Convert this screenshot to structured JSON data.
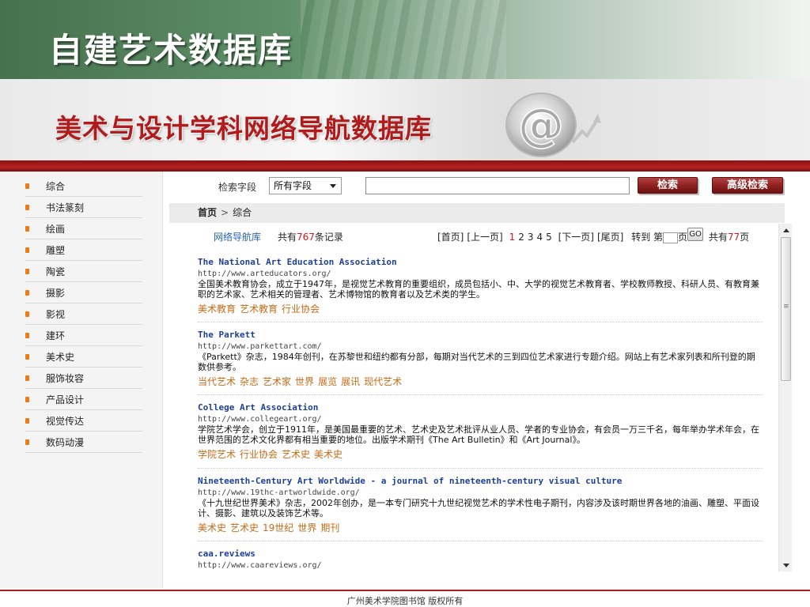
{
  "slide": {
    "title": "自建艺术数据库"
  },
  "banner": {
    "title": "美术与设计学科网络导航数据库",
    "logo_icon": "at-sign-icon"
  },
  "sidebar": {
    "items": [
      {
        "label": "综合"
      },
      {
        "label": "书法篆刻"
      },
      {
        "label": "绘画"
      },
      {
        "label": "雕塑"
      },
      {
        "label": "陶瓷"
      },
      {
        "label": "摄影"
      },
      {
        "label": "影视"
      },
      {
        "label": "建环"
      },
      {
        "label": "美术史"
      },
      {
        "label": "服饰妆容"
      },
      {
        "label": "产品设计"
      },
      {
        "label": "视觉传达"
      },
      {
        "label": "数码动漫"
      }
    ]
  },
  "search": {
    "field_label": "检索字段",
    "field_value": "所有字段",
    "input_value": "",
    "search_button": "检索",
    "advanced_button": "高级检索"
  },
  "breadcrumb": {
    "home": "首页",
    "separator": ">",
    "current": "综合"
  },
  "listing": {
    "db_link": "网络导航库",
    "count_prefix": "共有",
    "count": "767",
    "count_suffix": "条记录"
  },
  "pager": {
    "first": "[首页]",
    "prev": "[上一页]",
    "pages": [
      "1",
      "2",
      "3",
      "4",
      "5"
    ],
    "current_page": "1",
    "next": "[下一页]",
    "last": "[尾页]",
    "goto_prefix": "转到 第",
    "goto_suffix": "页",
    "go_button": "GO",
    "total_prefix": "共有",
    "total_pages": "77",
    "total_suffix": "页"
  },
  "results": [
    {
      "title": "The National Art Education Association",
      "url": "http://www.arteducators.org/",
      "description": "全国美术教育协会，成立于1947年，是视觉艺术教育的重要组织，成员包括小、中、大学的视觉艺术教育者、学校教师教授、科研人员、有教育兼职的艺术家、艺术相关的管理者、艺术博物馆的教育者以及艺术类的学生。",
      "tags": [
        "美术教育",
        "艺术教育",
        "行业协会"
      ]
    },
    {
      "title": "The Parkett",
      "url": "http://www.parkettart.com/",
      "description": "《Parkett》杂志，1984年创刊，在苏黎世和纽约都有分部，每期对当代艺术的三到四位艺术家进行专题介绍。网站上有艺术家列表和所刊登的期数供参考。",
      "tags": [
        "当代艺术",
        "杂志",
        "艺术家",
        "世界",
        "展览",
        "展讯",
        "现代艺术"
      ]
    },
    {
      "title": "College Art Association",
      "url": "http://www.collegeart.org/",
      "description": "学院艺术学会，创立于1911年，是美国最重要的艺术、艺术史及艺术批评从业人员、学者的专业协会，有会员一万三千名，每年举办学术年会，在世界范围的艺术文化界都有相当重要的地位。出版学术期刊《The Art Bulletin》和《Art Journal》。",
      "tags": [
        "学院艺术",
        "行业协会",
        "艺术史",
        "美术史"
      ]
    },
    {
      "title": "Nineteenth-Century Art Worldwide - a journal of nineteenth-century visual culture",
      "url": "http://www.19thc-artworldwide.org/",
      "description": "《十九世纪世界美术》杂志，2002年创办，是一本专门研究十九世纪视觉艺术的学术性电子期刊，内容涉及该时期世界各地的油画、雕塑、平面设计、摄影、建筑以及装饰艺术等。",
      "tags": [
        "美术史",
        "艺术史",
        "19世纪",
        "世界",
        "期刊"
      ]
    },
    {
      "title": "caa.reviews",
      "url": "http://www.caareviews.org/",
      "description": "",
      "tags": []
    }
  ],
  "footer": {
    "text": "广州美术学院图书馆 版权所有"
  }
}
